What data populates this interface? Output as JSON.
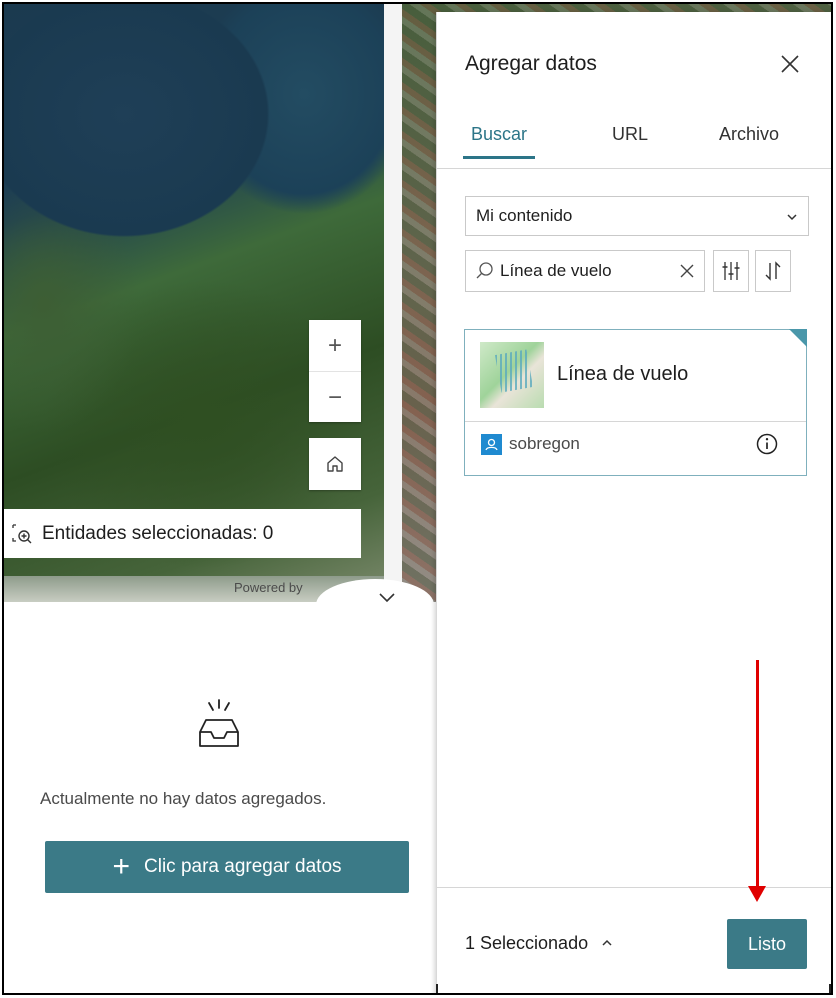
{
  "map": {
    "zoom_in": "+",
    "zoom_out": "−",
    "home_icon": "home-icon",
    "selected_features": "Entidades seleccionadas: 0",
    "attribution": "Powered by",
    "collapse_icon": "chevron-down-icon"
  },
  "empty_state": {
    "icon": "empty-tray-icon",
    "message": "Actualmente no hay datos agregados.",
    "add_button": "Clic para agregar datos"
  },
  "add_data_panel": {
    "title": "Agregar datos",
    "tabs": [
      {
        "label": "Buscar",
        "active": true
      },
      {
        "label": "URL",
        "active": false
      },
      {
        "label": "Archivo",
        "active": false
      }
    ],
    "scope_select": {
      "value": "Mi contenido"
    },
    "search": {
      "value": "Línea de vuelo"
    },
    "results": [
      {
        "title": "Línea de vuelo",
        "owner": "sobregon",
        "selected": true
      }
    ],
    "footer": {
      "selected_count": "1 Seleccionado",
      "done_button": "Listo"
    }
  },
  "colors": {
    "accent": "#3b7a87",
    "tab_active": "#2c7588",
    "annotation_arrow": "#e00000"
  }
}
